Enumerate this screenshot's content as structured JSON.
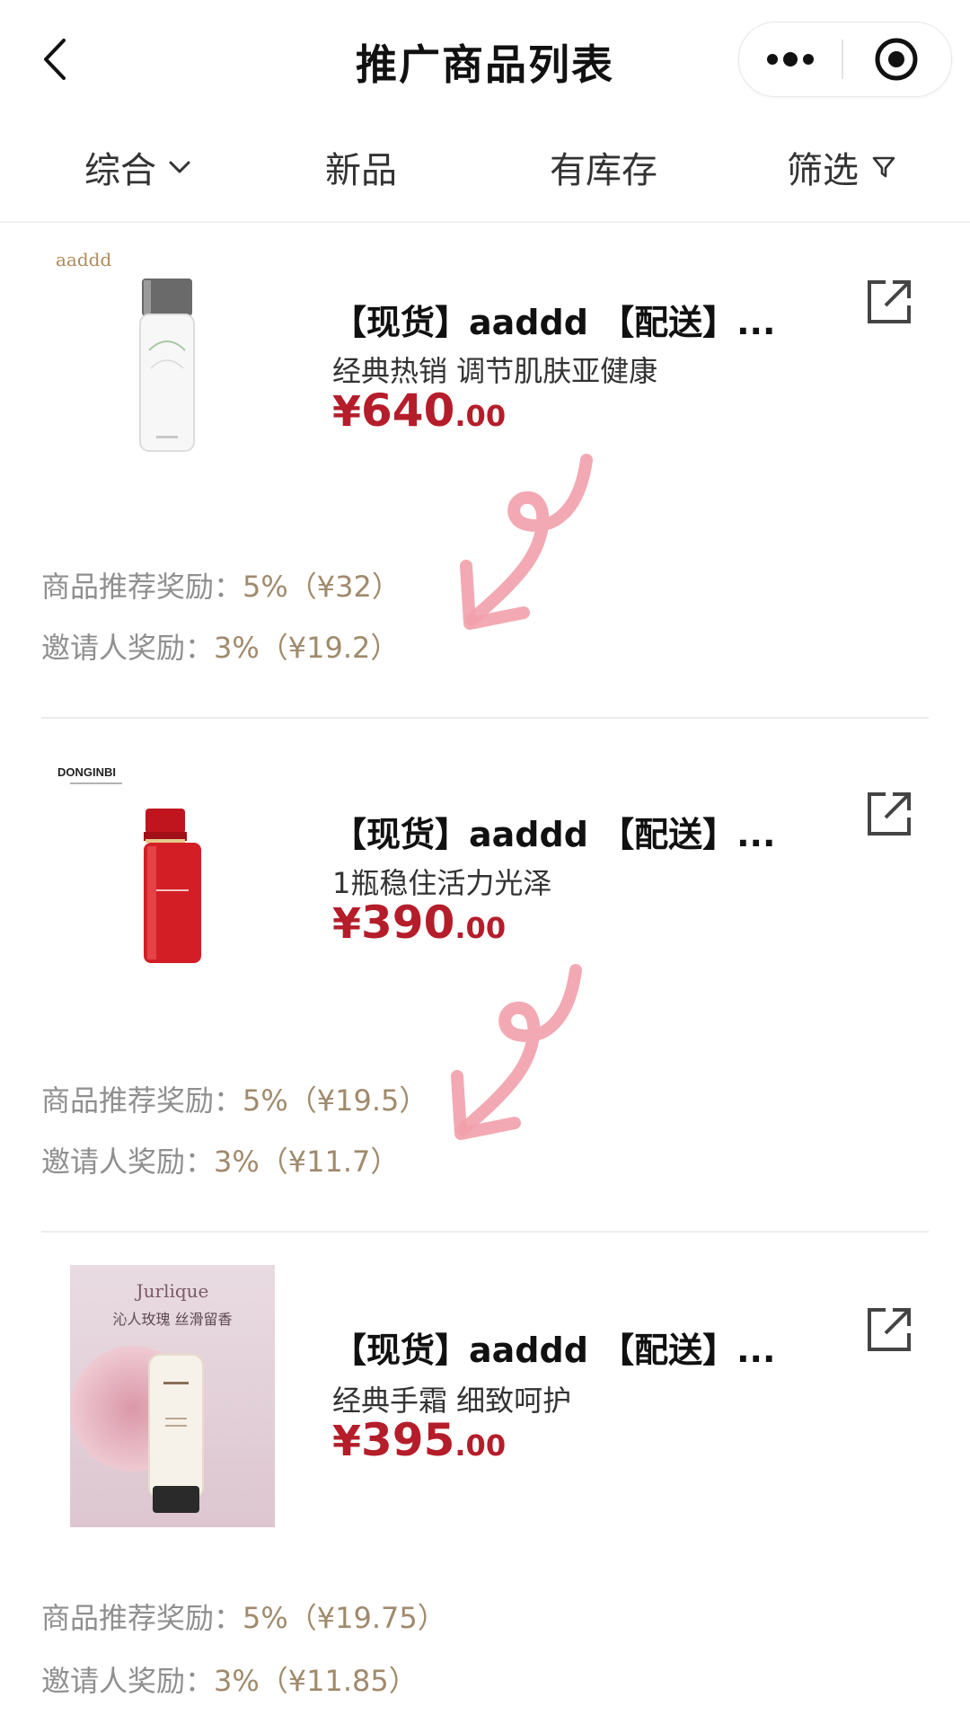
{
  "nav": {
    "title": "推广商品列表"
  },
  "filters": [
    {
      "label": "综合"
    },
    {
      "label": "新品"
    },
    {
      "label": "有库存"
    },
    {
      "label": "筛选"
    }
  ],
  "products": [
    {
      "brand_logo": "aaddd",
      "title": "【现货】aaddd 【配送】...",
      "desc": "经典热销 调节肌肤亚健康",
      "price_symbol": "¥",
      "price_int": "640",
      "price_dec": ".00",
      "reward1_label": "商品推荐奖励：",
      "reward1_value": "5%（¥32）",
      "reward2_label": "邀请人奖励：",
      "reward2_value": "3%（¥19.2）"
    },
    {
      "brand_logo": "DONGINBI",
      "title": "【现货】aaddd 【配送】...",
      "desc": "1瓶稳住活力光泽",
      "price_symbol": "¥",
      "price_int": "390",
      "price_dec": ".00",
      "reward1_label": "商品推荐奖励：",
      "reward1_value": "5%（¥19.5）",
      "reward2_label": "邀请人奖励：",
      "reward2_value": "3%（¥11.7）"
    },
    {
      "brand_logo": "Jurlique",
      "poster_text": "沁人玫瑰 丝滑留香",
      "title": "【现货】aaddd 【配送】...",
      "desc": "经典手霜 细致呵护",
      "price_symbol": "¥",
      "price_int": "395",
      "price_dec": ".00",
      "reward1_label": "商品推荐奖励：",
      "reward1_value": "5%（¥19.75）",
      "reward2_label": "邀请人奖励：",
      "reward2_value": "3%（¥11.85）"
    }
  ],
  "icons": {
    "back": "chevron-left-icon",
    "more": "more-dots-icon",
    "close": "target-circle-icon",
    "sort": "chevron-down-icon",
    "filter": "funnel-icon",
    "share": "external-link-icon"
  },
  "colors": {
    "price": "#b51d2a",
    "reward_value": "#a08a6c",
    "annotation_arrow": "#f2a0ab"
  }
}
